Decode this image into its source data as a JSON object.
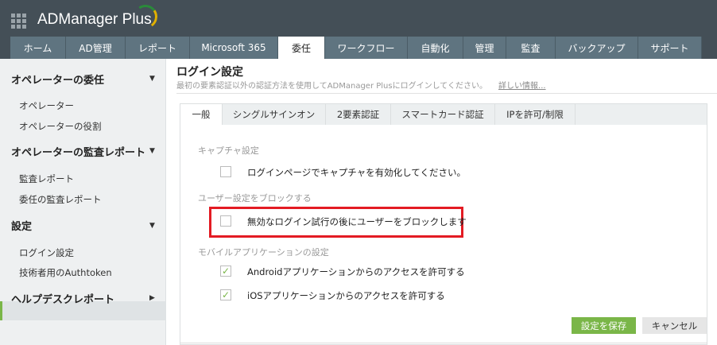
{
  "app": {
    "title": "ADManager Plus"
  },
  "nav": [
    {
      "label": "ホーム"
    },
    {
      "label": "AD管理"
    },
    {
      "label": "レポート"
    },
    {
      "label": "Microsoft 365"
    },
    {
      "label": "委任"
    },
    {
      "label": "ワークフロー"
    },
    {
      "label": "自動化"
    },
    {
      "label": "管理"
    },
    {
      "label": "監査"
    },
    {
      "label": "バックアップ"
    },
    {
      "label": "サポート"
    }
  ],
  "sidebar": {
    "h1": "オペレーターの委任",
    "i1": "オペレーター",
    "i2": "オペレーターの役割",
    "h2": "オペレーターの監査レポート",
    "i3": "監査レポート",
    "i4": "委任の監査レポート",
    "h3": "設定",
    "i5": "ログイン設定",
    "i6": "技術者用のAuthtoken",
    "h4": "ヘルプデスクレポート"
  },
  "page": {
    "title": "ログイン設定",
    "desc": "最初の要素認証以外の認証方法を使用してADManager Plusにログインしてください。",
    "more": "詳しい情報..."
  },
  "tabs": [
    {
      "label": "一般"
    },
    {
      "label": "シングルサインオン"
    },
    {
      "label": "2要素認証"
    },
    {
      "label": "スマートカード認証"
    },
    {
      "label": "IPを許可/制限"
    }
  ],
  "form": {
    "captcha_section": "キャプチャ設定",
    "captcha": "ログインページでキャプチャを有効化してください。",
    "block_section": "ユーザー設定をブロックする",
    "block": "無効なログイン試行の後にユーザーをブロックします",
    "mobile_section": "モバイルアプリケーションの設定",
    "android": "Androidアプリケーションからのアクセスを許可する",
    "ios": "iOSアプリケーションからのアクセスを許可する",
    "check": "✓",
    "save": "設定を保存",
    "cancel": "キャンセル"
  },
  "colors": {
    "accent": "#7ab648",
    "header": "#444f57",
    "nav": "#5f7480",
    "highlight": "#e31b23"
  }
}
